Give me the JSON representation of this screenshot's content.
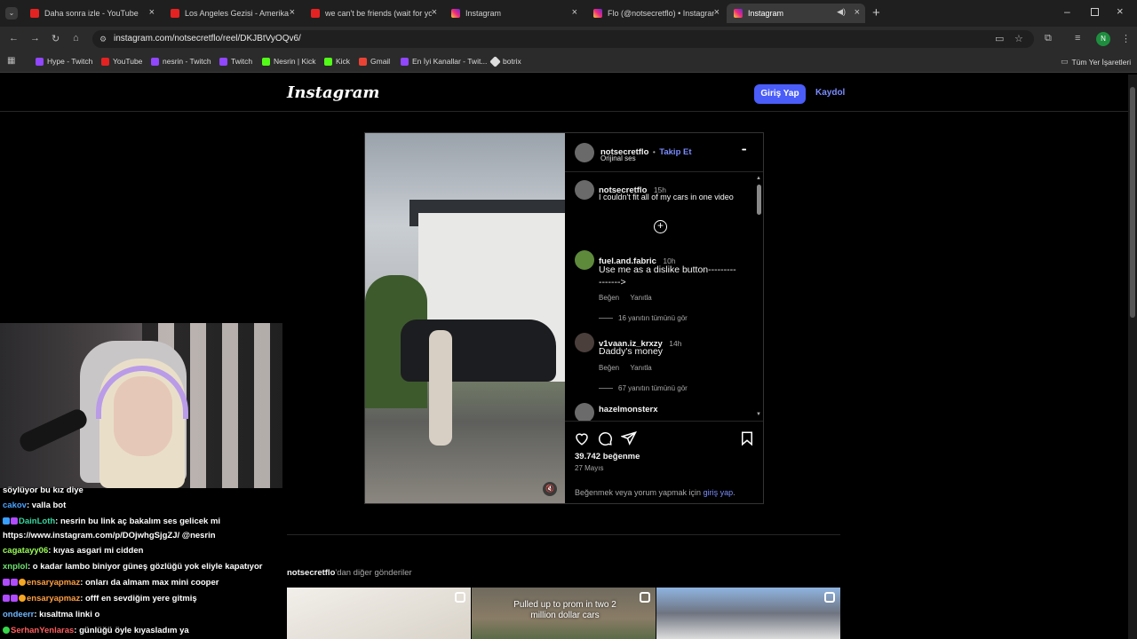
{
  "browser": {
    "tabs": [
      {
        "label": "Daha sonra izle - YouTube",
        "icon": "youtube-icon"
      },
      {
        "label": "Los Angeles Gezisi - Amerika V",
        "icon": "youtube-icon"
      },
      {
        "label": "we can't be friends (wait for yo",
        "icon": "youtube-icon"
      },
      {
        "label": "Instagram",
        "icon": "instagram-icon"
      },
      {
        "label": "Flo (@notsecretflo) • Instagram",
        "icon": "instagram-icon"
      },
      {
        "label": "Instagram",
        "icon": "instagram-icon",
        "active": true
      }
    ],
    "url": "instagram.com/notsecretflo/reel/DKJBtVyOQv6/",
    "profile_initial": "N",
    "bookmarks": [
      "Hype - Twitch",
      "YouTube",
      "nesrin - Twitch",
      "Twitch",
      "Nesrin | Kick",
      "Kick",
      "Gmail",
      "En İyi Kanallar - Twit...",
      "botrix"
    ],
    "all_bookmarks": "Tüm Yer İşaretleri"
  },
  "header": {
    "logo": "Instagram",
    "login": "Giriş Yap",
    "signup": "Kaydol"
  },
  "post": {
    "author": "notsecretflo",
    "dot": "•",
    "follow": "Takip Et",
    "audio": "Orijinal ses",
    "more": "•••",
    "caption_user": "notsecretflo",
    "caption_time": "15h",
    "caption": "I couldn't fit all of my cars in one video",
    "comments": [
      {
        "user": "fuel.and.fabric",
        "time": "10h",
        "text": "Use me as a dislike button---------\n------->",
        "like": "Beğen",
        "reply": "Yanıtla",
        "view_replies": "16 yanıtın tümünü gör"
      },
      {
        "user": "v1vaan.iz_krxzy",
        "time": "14h",
        "text": "Daddy's money",
        "like": "Beğen",
        "reply": "Yanıtla",
        "view_replies": "67 yanıtın tümünü gör"
      },
      {
        "user": "hazelmonsterx"
      }
    ],
    "likes": "39.742 beğenme",
    "date": "27 Mayıs",
    "login_prompt_prefix": "Beğenmek veya yorum yapmak için ",
    "login_prompt_link": "giriş yap",
    "login_prompt_suffix": "."
  },
  "more_posts": {
    "label_user": "notsecretflo",
    "label_suffix": "'dan diğer gönderiler",
    "thumb2_text": "Pulled up to prom in two 2 million dollar cars"
  },
  "chat": [
    {
      "user": "",
      "text": "söylüyor bu kız diye",
      "color": "#ffffff"
    },
    {
      "user": "cakov",
      "text": ": valla bot",
      "color": "#4aa3ff"
    },
    {
      "user": "DainLoth",
      "text": ": nesrin bu link aç bakalım ses gelicek mi",
      "color": "#37d6a0"
    },
    {
      "user": "",
      "text": "https://www.instagram.com/p/DOjwhgSjgZJ/ @nesrin",
      "color": "#ffffff"
    },
    {
      "user": "cagatayy06",
      "text": ": kıyas asgari mi cidden",
      "color": "#9bff57"
    },
    {
      "user": "xnplol",
      "text": ": o kadar lambo biniyor güneş gözlüğü yok eliyle kapatıyor",
      "color": "#6fe36f"
    },
    {
      "user": "ensaryapmaz",
      "text": ": onları da almam max mini cooper",
      "color": "#ff9f43"
    },
    {
      "user": "ensaryapmaz",
      "text": ": offf en sevdiğim yere gitmiş",
      "color": "#ff9f43"
    },
    {
      "user": "ondeerr",
      "text": ": kısaltma linki o",
      "color": "#6fb6ff"
    },
    {
      "user": "SerhanYenlaras",
      "text": ": günlüğü öyle kıyasladım ya",
      "color": "#ff5e5e"
    }
  ]
}
